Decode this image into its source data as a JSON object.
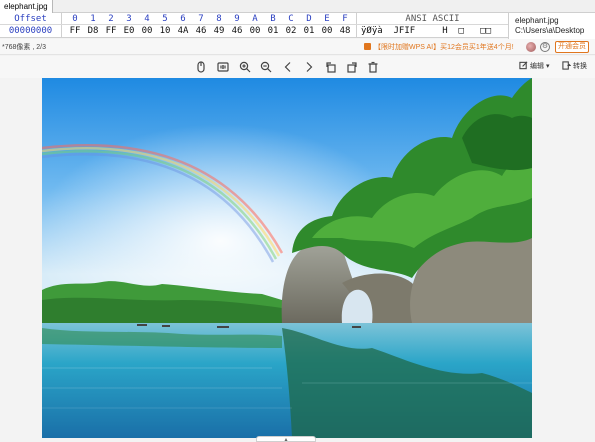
{
  "tab": {
    "file_name": "elephant.jpg"
  },
  "hex_view": {
    "offset_header": "Offset",
    "column_headers": [
      "0",
      "1",
      "2",
      "3",
      "4",
      "5",
      "6",
      "7",
      "8",
      "9",
      "A",
      "B",
      "C",
      "D",
      "E",
      "F"
    ],
    "ascii_header": "ANSI ASCII",
    "rows": [
      {
        "offset": "00000000",
        "bytes": [
          "FF",
          "D8",
          "FF",
          "E0",
          "00",
          "10",
          "4A",
          "46",
          "49",
          "46",
          "00",
          "01",
          "02",
          "01",
          "00",
          "48"
        ],
        "ascii": "ÿØÿà  JFIF     H  □   □□"
      }
    ]
  },
  "file_info": {
    "name": "elephant.jpg",
    "path": "C:\\Users\\a\\Desktop"
  },
  "viewer": {
    "dimensions": "*768像素",
    "page": "2/3",
    "promo": "【限时加赠WPS AI】买12会员买1年送4个月!",
    "member_button": "开通会员",
    "edit_label": "编辑",
    "convert_label": "转换"
  },
  "icons": [
    "mouse-icon",
    "actual-size-icon",
    "zoom-in-icon",
    "zoom-out-icon",
    "prev-icon",
    "next-icon",
    "rotate-left-icon",
    "rotate-right-icon",
    "delete-icon"
  ]
}
